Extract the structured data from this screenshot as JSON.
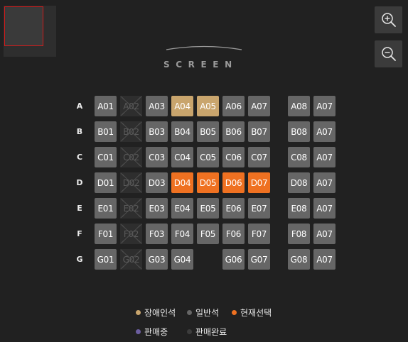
{
  "screen": {
    "label": "SCREEN"
  },
  "zoom": {
    "in_icon": "zoom-in-icon",
    "out_icon": "zoom-out-icon"
  },
  "colors": {
    "available": "#666666",
    "accessible": "#c9a56d",
    "selected": "#ef7121",
    "in_sale": "#6c5ea0",
    "sold": "#3c3c3c"
  },
  "rows": [
    {
      "label": "A",
      "seats": [
        {
          "label": "A01",
          "status": "available"
        },
        {
          "label": "A02",
          "status": "sold"
        },
        {
          "label": "A03",
          "status": "available"
        },
        {
          "label": "A04",
          "status": "accessible"
        },
        {
          "label": "A05",
          "status": "accessible"
        },
        {
          "label": "A06",
          "status": "available"
        },
        {
          "label": "A07",
          "status": "available"
        },
        {
          "label": "A08",
          "status": "available"
        },
        {
          "label": "A07",
          "status": "available"
        }
      ]
    },
    {
      "label": "B",
      "seats": [
        {
          "label": "B01",
          "status": "available"
        },
        {
          "label": "B02",
          "status": "sold"
        },
        {
          "label": "B03",
          "status": "available"
        },
        {
          "label": "B04",
          "status": "available"
        },
        {
          "label": "B05",
          "status": "available"
        },
        {
          "label": "B06",
          "status": "available"
        },
        {
          "label": "B07",
          "status": "available"
        },
        {
          "label": "B08",
          "status": "available"
        },
        {
          "label": "A07",
          "status": "available"
        }
      ]
    },
    {
      "label": "C",
      "seats": [
        {
          "label": "C01",
          "status": "available"
        },
        {
          "label": "C02",
          "status": "sold"
        },
        {
          "label": "C03",
          "status": "available"
        },
        {
          "label": "C04",
          "status": "available"
        },
        {
          "label": "C05",
          "status": "available"
        },
        {
          "label": "C06",
          "status": "available"
        },
        {
          "label": "C07",
          "status": "available"
        },
        {
          "label": "C08",
          "status": "available"
        },
        {
          "label": "A07",
          "status": "available"
        }
      ]
    },
    {
      "label": "D",
      "seats": [
        {
          "label": "D01",
          "status": "available"
        },
        {
          "label": "D02",
          "status": "sold"
        },
        {
          "label": "D03",
          "status": "available"
        },
        {
          "label": "D04",
          "status": "selected"
        },
        {
          "label": "D05",
          "status": "selected"
        },
        {
          "label": "D06",
          "status": "selected"
        },
        {
          "label": "D07",
          "status": "selected"
        },
        {
          "label": "D08",
          "status": "available"
        },
        {
          "label": "A07",
          "status": "available"
        }
      ]
    },
    {
      "label": "E",
      "seats": [
        {
          "label": "E01",
          "status": "available"
        },
        {
          "label": "E02",
          "status": "sold"
        },
        {
          "label": "E03",
          "status": "available"
        },
        {
          "label": "E04",
          "status": "available"
        },
        {
          "label": "E05",
          "status": "available"
        },
        {
          "label": "E06",
          "status": "available"
        },
        {
          "label": "E07",
          "status": "available"
        },
        {
          "label": "E08",
          "status": "available"
        },
        {
          "label": "A07",
          "status": "available"
        }
      ]
    },
    {
      "label": "F",
      "seats": [
        {
          "label": "F01",
          "status": "available"
        },
        {
          "label": "F02",
          "status": "sold"
        },
        {
          "label": "F03",
          "status": "available"
        },
        {
          "label": "F04",
          "status": "available"
        },
        {
          "label": "F05",
          "status": "available"
        },
        {
          "label": "F06",
          "status": "available"
        },
        {
          "label": "F07",
          "status": "available"
        },
        {
          "label": "F08",
          "status": "available"
        },
        {
          "label": "A07",
          "status": "available"
        }
      ]
    },
    {
      "label": "G",
      "seats": [
        {
          "label": "G01",
          "status": "available"
        },
        {
          "label": "G02",
          "status": "sold"
        },
        {
          "label": "G03",
          "status": "available"
        },
        {
          "label": "G04",
          "status": "available"
        },
        {
          "label": "",
          "status": "empty"
        },
        {
          "label": "G06",
          "status": "available"
        },
        {
          "label": "G07",
          "status": "available"
        },
        {
          "label": "G08",
          "status": "available"
        },
        {
          "label": "A07",
          "status": "available"
        }
      ]
    }
  ],
  "legend": [
    {
      "label": "장애인석",
      "color": "#c9a56d"
    },
    {
      "label": "일반석",
      "color": "#666666"
    },
    {
      "label": "현재선택",
      "color": "#ef7121"
    },
    {
      "label": "판매중",
      "color": "#6c5ea0"
    },
    {
      "label": "판매완료",
      "color": "#3c3c3c"
    }
  ]
}
